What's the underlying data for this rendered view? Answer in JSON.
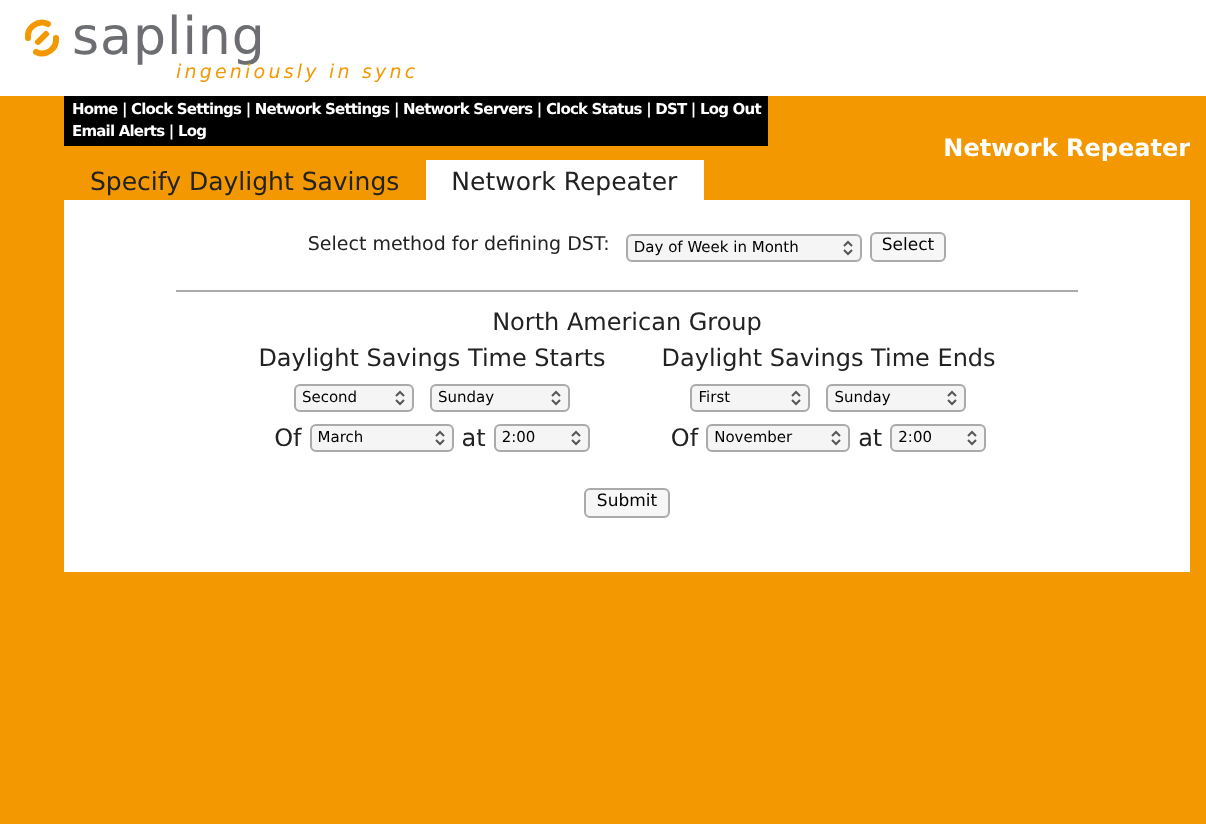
{
  "logo": {
    "name": "sapling",
    "tagline": "ingeniously in sync"
  },
  "nav": {
    "separator": "|",
    "rows": [
      [
        "Home",
        "Clock Settings",
        "Network Settings",
        "Network Servers",
        "Clock Status",
        "DST",
        "Log Out"
      ],
      [
        "Email Alerts",
        "Log"
      ]
    ]
  },
  "page_title": "Network Repeater",
  "tabs": [
    {
      "label": "Specify Daylight Savings",
      "selected": false
    },
    {
      "label": "Network Repeater",
      "selected": true
    }
  ],
  "method": {
    "label": "Select method for defining DST:",
    "value": "Day of Week in Month",
    "button": "Select"
  },
  "group_title": "North American Group",
  "sections": [
    {
      "title": "Daylight Savings Time Starts",
      "week": "Second",
      "day": "Sunday",
      "of_label": "Of",
      "month": "March",
      "at_label": "at",
      "time": "2:00"
    },
    {
      "title": "Daylight Savings Time Ends",
      "week": "First",
      "day": "Sunday",
      "of_label": "Of",
      "month": "November",
      "at_label": "at",
      "time": "2:00"
    }
  ],
  "submit": "Submit"
}
